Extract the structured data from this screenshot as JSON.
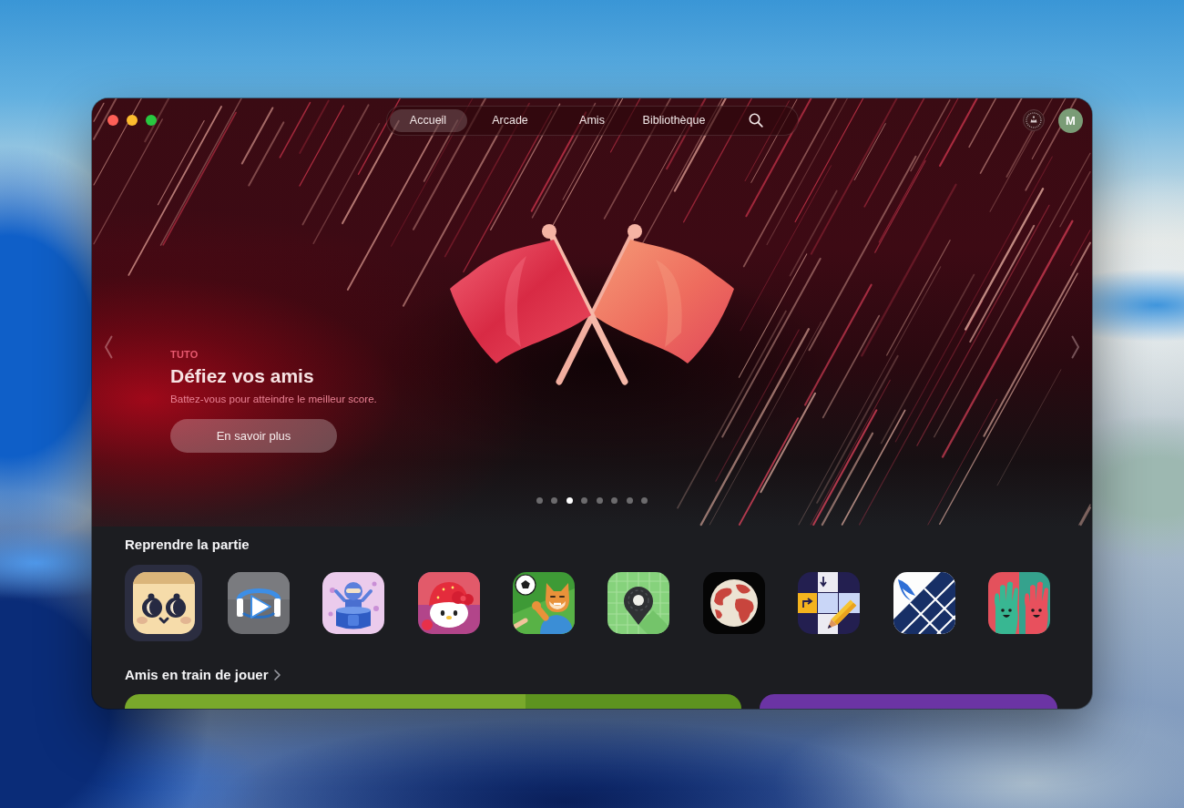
{
  "nav": {
    "tabs": [
      {
        "label": "Accueil",
        "selected": true
      },
      {
        "label": "Arcade",
        "selected": false
      },
      {
        "label": "Amis",
        "selected": false
      },
      {
        "label": "Bibliothèque",
        "selected": false
      }
    ]
  },
  "account": {
    "initial": "M"
  },
  "hero": {
    "eyebrow": "TUTO",
    "title": "Défiez vos amis",
    "subtitle": "Battez-vous pour atteindre le meilleur score.",
    "button": "En savoir plus",
    "pages": [
      {
        "selected": false
      },
      {
        "selected": false
      },
      {
        "selected": true
      },
      {
        "selected": false
      },
      {
        "selected": false
      },
      {
        "selected": false
      },
      {
        "selected": false
      },
      {
        "selected": false
      }
    ]
  },
  "continue_playing": {
    "title": "Reprendre la partie",
    "games": [
      {
        "kind": "face",
        "selected": true
      },
      {
        "kind": "play",
        "selected": false
      },
      {
        "kind": "figure",
        "selected": false
      },
      {
        "kind": "cat",
        "selected": false
      },
      {
        "kind": "soccer",
        "selected": false
      },
      {
        "kind": "pin",
        "selected": false
      },
      {
        "kind": "globe",
        "selected": false
      },
      {
        "kind": "crossword",
        "selected": false
      },
      {
        "kind": "grid",
        "selected": false
      },
      {
        "kind": "hands",
        "selected": false
      }
    ]
  },
  "friends_playing": {
    "title": "Amis en train de jouer",
    "cards": [
      {
        "color": "#79a92b",
        "artwork": true
      },
      {
        "color": "#6b34a4",
        "artwork": false
      }
    ]
  }
}
